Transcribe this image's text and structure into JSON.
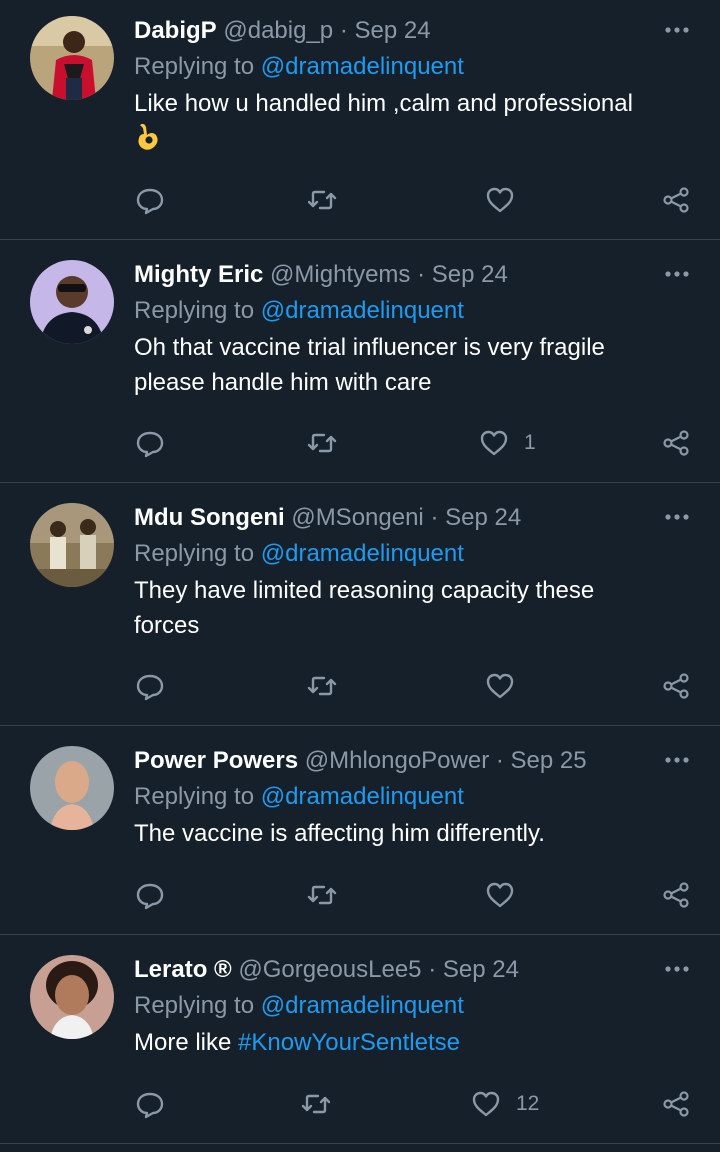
{
  "colors": {
    "background": "#15202b",
    "divider": "#38444d",
    "secondary_text": "#8b98a5",
    "link": "#1d9bf0"
  },
  "tweets": [
    {
      "name": "DabigP",
      "handle": "@dabig_p",
      "separator": "·",
      "date": "Sep 24",
      "replying_prefix": "Replying to",
      "replying_to": "@dramadelinquent",
      "text": "Like how u handled him ,calm and professional",
      "emoji": "👌",
      "like_count": ""
    },
    {
      "name": "Mighty Eric",
      "handle": "@Mightyems",
      "separator": "·",
      "date": "Sep 24",
      "replying_prefix": "Replying to",
      "replying_to": "@dramadelinquent",
      "text_line1": "Oh that vaccine trial influencer is very fragile",
      "text_line2": "please handle him with care",
      "like_count": "1"
    },
    {
      "name": "Mdu Songeni",
      "handle": "@MSongeni",
      "separator": "·",
      "date": "Sep 24",
      "replying_prefix": "Replying to",
      "replying_to": "@dramadelinquent",
      "text_line1": "They have limited reasoning capacity these",
      "text_line2": "forces",
      "like_count": ""
    },
    {
      "name": "Power Powers",
      "handle": "@MhlongoPower",
      "separator": "·",
      "date": "Sep 25",
      "replying_prefix": "Replying to",
      "replying_to": "@dramadelinquent",
      "text": "The vaccine is affecting him differently.",
      "like_count": ""
    },
    {
      "name": "Lerato ®",
      "handle": "@GorgeousLee5",
      "separator": "·",
      "date": "Sep 24",
      "replying_prefix": "Replying to",
      "replying_to": "@dramadelinquent",
      "text_prefix": "More like",
      "hashtag": "#KnowYourSentletse",
      "like_count": "12"
    }
  ]
}
